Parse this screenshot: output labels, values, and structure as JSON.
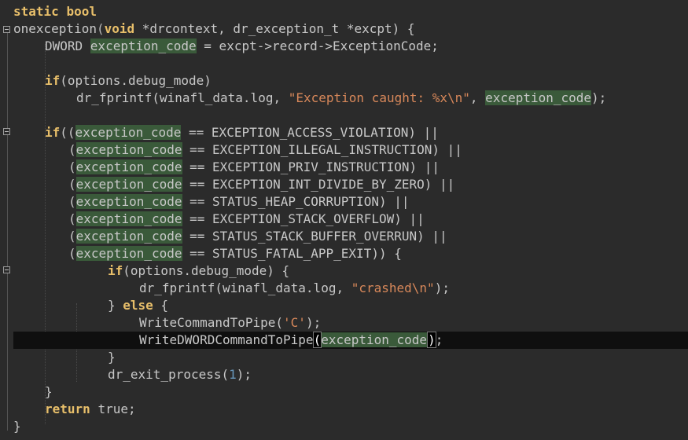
{
  "editor": {
    "lines": [
      "static bool",
      "onexception(void *drcontext, dr_exception_t *excpt) {",
      "DWORD exception_code = excpt->record->ExceptionCode;",
      "",
      "if(options.debug_mode)",
      "dr_fprintf(winafl_data.log, \"Exception caught: %x\\n\", exception_code);",
      "",
      "if((exception_code == EXCEPTION_ACCESS_VIOLATION) ||",
      "(exception_code == EXCEPTION_ILLEGAL_INSTRUCTION) ||",
      "(exception_code == EXCEPTION_PRIV_INSTRUCTION) ||",
      "(exception_code == EXCEPTION_INT_DIVIDE_BY_ZERO) ||",
      "(exception_code == STATUS_HEAP_CORRUPTION) ||",
      "(exception_code == EXCEPTION_STACK_OVERFLOW) ||",
      "(exception_code == STATUS_STACK_BUFFER_OVERRUN) ||",
      "(exception_code == STATUS_FATAL_APP_EXIT)) {",
      "if(options.debug_mode) {",
      "dr_fprintf(winafl_data.log, \"crashed\\n\");",
      "} else {",
      "WriteCommandToPipe('C');",
      "WriteDWORDCommandToPipe(exception_code);",
      "}",
      "dr_exit_process(1);",
      "}",
      "return true;",
      "}"
    ],
    "tokens": {
      "static": "static",
      "bool": "bool",
      "void": "void",
      "if": "if",
      "else": "else",
      "return": "return",
      "true": "true",
      "fn_name": "onexception",
      "var": "exception_code",
      "str_caught": "\"Exception caught: %x\\n\"",
      "str_crashed": "\"crashed\\n\"",
      "char_c": "'C'",
      "one": "1"
    },
    "colors": {
      "background": "#2b2b2b",
      "current_line": "#0f0f0f",
      "keyword": "#cc7832",
      "string": "#d8885a",
      "number": "#6897bb",
      "identifier_highlight": "#3a5a3a"
    },
    "current_line": 20
  }
}
